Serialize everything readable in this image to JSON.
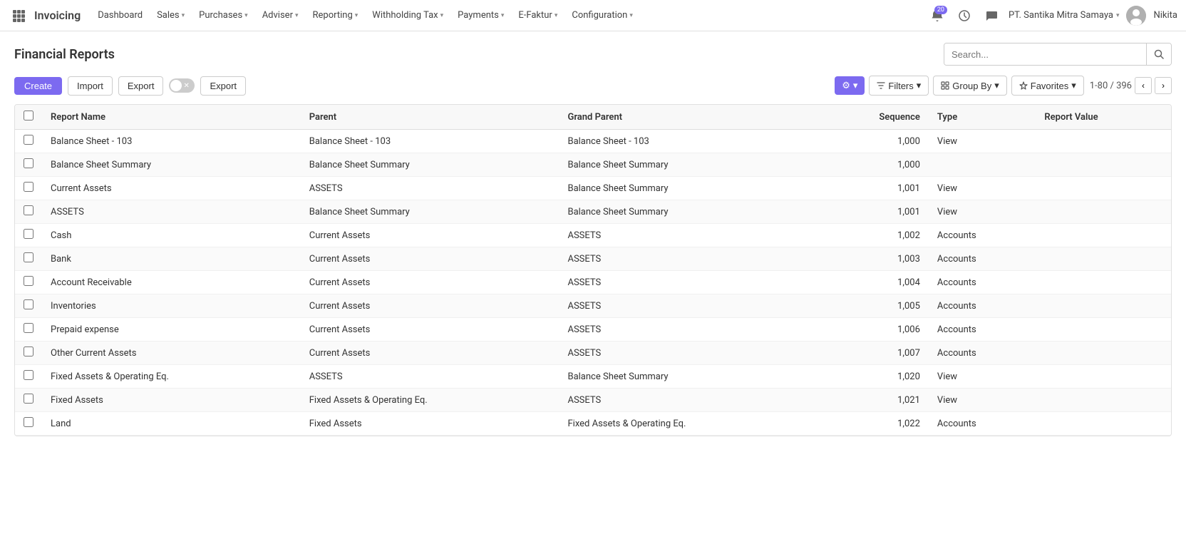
{
  "app": {
    "name": "Invoicing"
  },
  "nav": {
    "items": [
      {
        "label": "Dashboard",
        "hasDropdown": false
      },
      {
        "label": "Sales",
        "hasDropdown": true
      },
      {
        "label": "Purchases",
        "hasDropdown": true
      },
      {
        "label": "Adviser",
        "hasDropdown": true
      },
      {
        "label": "Reporting",
        "hasDropdown": true
      },
      {
        "label": "Withholding Tax",
        "hasDropdown": true
      },
      {
        "label": "Payments",
        "hasDropdown": true
      },
      {
        "label": "E-Faktur",
        "hasDropdown": true
      },
      {
        "label": "Configuration",
        "hasDropdown": true
      }
    ],
    "notifications": "20",
    "company": "PT. Santika Mitra Samaya",
    "username": "Nikita"
  },
  "page": {
    "title": "Financial Reports",
    "search_placeholder": "Search..."
  },
  "toolbar": {
    "create_label": "Create",
    "import_label": "Import",
    "export_label_1": "Export",
    "export_label_2": "Export",
    "gear_icon": "⚙",
    "filters_label": "Filters",
    "group_by_label": "Group By",
    "favorites_label": "Favorites",
    "pagination_text": "1-80 / 396"
  },
  "table": {
    "columns": [
      {
        "key": "report_name",
        "label": "Report Name"
      },
      {
        "key": "parent",
        "label": "Parent"
      },
      {
        "key": "grand_parent",
        "label": "Grand Parent"
      },
      {
        "key": "sequence",
        "label": "Sequence"
      },
      {
        "key": "type",
        "label": "Type"
      },
      {
        "key": "report_value",
        "label": "Report Value"
      }
    ],
    "rows": [
      {
        "report_name": "Balance Sheet - 103",
        "parent": "Balance Sheet - 103",
        "grand_parent": "Balance Sheet - 103",
        "sequence": "1,000",
        "type": "View",
        "report_value": ""
      },
      {
        "report_name": "Balance Sheet Summary",
        "parent": "Balance Sheet Summary",
        "grand_parent": "Balance Sheet Summary",
        "sequence": "1,000",
        "type": "",
        "report_value": ""
      },
      {
        "report_name": "Current Assets",
        "parent": "ASSETS",
        "grand_parent": "Balance Sheet Summary",
        "sequence": "1,001",
        "type": "View",
        "report_value": ""
      },
      {
        "report_name": "ASSETS",
        "parent": "Balance Sheet Summary",
        "grand_parent": "Balance Sheet Summary",
        "sequence": "1,001",
        "type": "View",
        "report_value": ""
      },
      {
        "report_name": "Cash",
        "parent": "Current Assets",
        "grand_parent": "ASSETS",
        "sequence": "1,002",
        "type": "Accounts",
        "report_value": ""
      },
      {
        "report_name": "Bank",
        "parent": "Current Assets",
        "grand_parent": "ASSETS",
        "sequence": "1,003",
        "type": "Accounts",
        "report_value": ""
      },
      {
        "report_name": "Account Receivable",
        "parent": "Current Assets",
        "grand_parent": "ASSETS",
        "sequence": "1,004",
        "type": "Accounts",
        "report_value": ""
      },
      {
        "report_name": "Inventories",
        "parent": "Current Assets",
        "grand_parent": "ASSETS",
        "sequence": "1,005",
        "type": "Accounts",
        "report_value": ""
      },
      {
        "report_name": "Prepaid expense",
        "parent": "Current Assets",
        "grand_parent": "ASSETS",
        "sequence": "1,006",
        "type": "Accounts",
        "report_value": ""
      },
      {
        "report_name": "Other Current Assets",
        "parent": "Current Assets",
        "grand_parent": "ASSETS",
        "sequence": "1,007",
        "type": "Accounts",
        "report_value": ""
      },
      {
        "report_name": "Fixed Assets & Operating Eq.",
        "parent": "ASSETS",
        "grand_parent": "Balance Sheet Summary",
        "sequence": "1,020",
        "type": "View",
        "report_value": ""
      },
      {
        "report_name": "Fixed Assets",
        "parent": "Fixed Assets & Operating Eq.",
        "grand_parent": "ASSETS",
        "sequence": "1,021",
        "type": "View",
        "report_value": ""
      },
      {
        "report_name": "Land",
        "parent": "Fixed Assets",
        "grand_parent": "Fixed Assets & Operating Eq.",
        "sequence": "1,022",
        "type": "Accounts",
        "report_value": ""
      }
    ]
  }
}
